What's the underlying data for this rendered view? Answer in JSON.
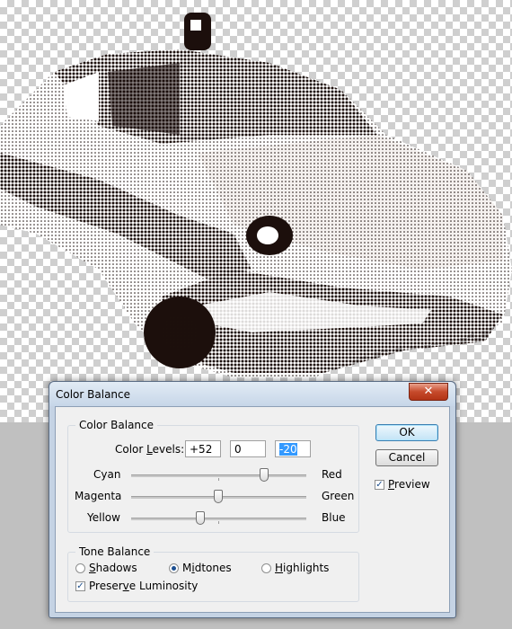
{
  "dialog": {
    "title": "Color Balance",
    "close_glyph": "✕"
  },
  "color_balance": {
    "legend": "Color Balance",
    "levels_label": "Color Levels:",
    "levels": [
      "+52",
      "0",
      "-20"
    ],
    "sliders": [
      {
        "left": "Cyan",
        "right": "Red",
        "value": 52
      },
      {
        "left": "Magenta",
        "right": "Green",
        "value": 0
      },
      {
        "left": "Yellow",
        "right": "Blue",
        "value": -20
      }
    ]
  },
  "tone_balance": {
    "legend": "Tone Balance",
    "options": [
      {
        "label": "Shadows",
        "selected": false
      },
      {
        "label": "Midtones",
        "selected": true
      },
      {
        "label": "Highlights",
        "selected": false
      }
    ],
    "preserve_luminosity": {
      "label": "Preserve Luminosity",
      "checked": true
    }
  },
  "buttons": {
    "ok": "OK",
    "cancel": "Cancel"
  },
  "preview": {
    "label": "Preview",
    "checked": true
  },
  "icons": {
    "close": "close-icon",
    "check": "checkmark-icon"
  },
  "colors": {
    "halftone_ink": "#1c0f0c",
    "close_button": "#c64a2b",
    "selection": "#3399ff"
  }
}
